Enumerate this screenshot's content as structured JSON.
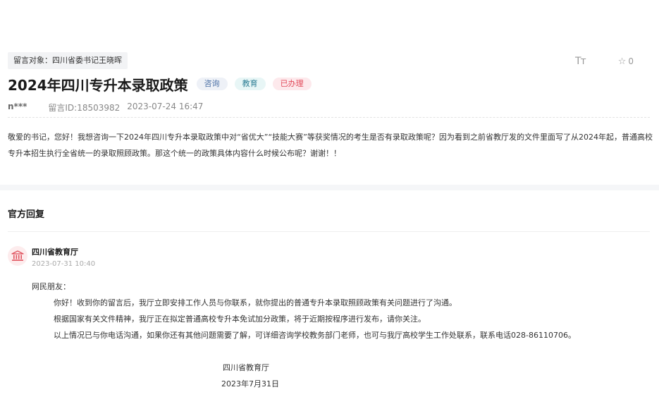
{
  "message": {
    "target": "留言对象：四川省委书记王晓晖",
    "title": "2024年四川专升本录取政策",
    "badges": {
      "category": "咨询",
      "field": "教育",
      "status": "已办理"
    },
    "tools": {
      "font_size_label": "Tт",
      "favorite_count": "0"
    },
    "author": "n***",
    "message_id": "留言ID:18503982",
    "date": "2023-07-24 16:47",
    "content": "敬爱的书记，您好！我想咨询一下2024年四川专升本录取政策中对“省优大”“技能大赛”等获奖情况的考生是否有录取政策呢？因为看到之前省教厅发的文件里面写了从2024年起，普通高校专升本招生执行全省统一的录取照顾政策。那这个统一的政策具体内容什么时候公布呢？谢谢！！"
  },
  "reply": {
    "section_title": "官方回复",
    "org_name": "四川省教育厅",
    "time": "2023-07-31 10:40",
    "greeting": "网民朋友：",
    "paragraphs": [
      "你好！收到你的留言后，我厅立即安排工作人员与你联系，就你提出的普通专升本录取照顾政策有关问题进行了沟通。",
      "根据国家有关文件精神，我厅正在拟定普通高校专升本免试加分政策，将于近期按程序进行发布，请你关注。",
      "以上情况已与你电话沟通，如果你还有其他问题需要了解，可详细咨询学校教务部门老师，也可与我厅高校学生工作处联系，联系电话028-86110706。"
    ],
    "signature_org": "四川省教育厅",
    "signature_date": "2023年7月31日"
  }
}
